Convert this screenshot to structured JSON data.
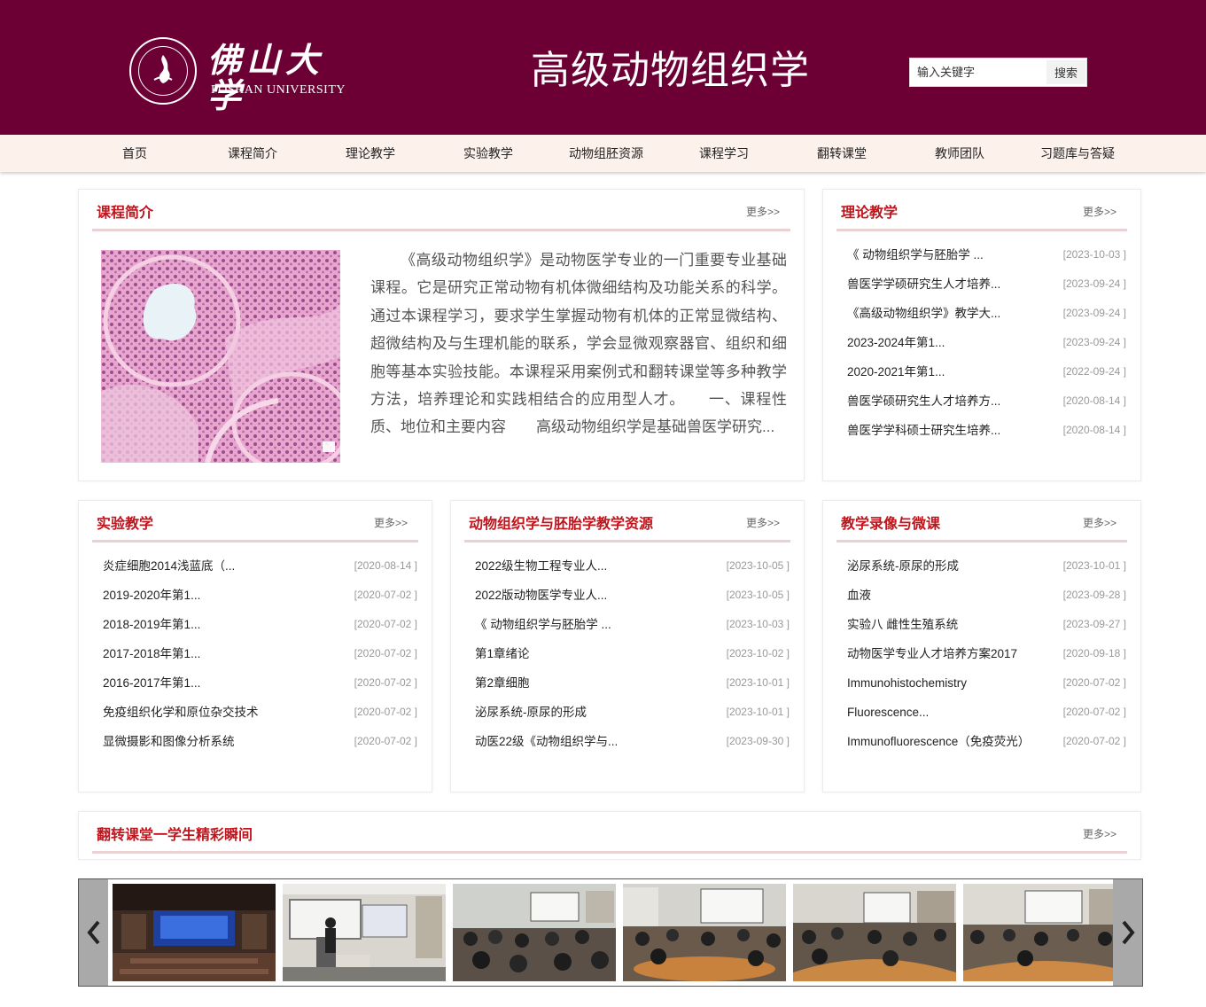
{
  "header": {
    "logo_cn": "佛山大学",
    "logo_en": "FOSHAN UNIVERSITY",
    "title": "高级动物组织学",
    "search_placeholder": "输入关键字",
    "search_button": "搜索"
  },
  "nav": {
    "items": [
      "首页",
      "课程简介",
      "理论教学",
      "实验教学",
      "动物组胚资源",
      "课程学习",
      "翻转课堂",
      "教师团队",
      "习题库与答疑"
    ]
  },
  "more_label": "更多>>",
  "intro": {
    "title": "课程简介",
    "image_icon": "histology-image",
    "text": "《高级动物组织学》是动物医学专业的一门重要专业基础课程。它是研究正常动物有机体微细结构及功能关系的科学。通过本课程学习，要求学生掌握动物有机体的正常显微结构、超微结构及与生理机能的联系，学会显微观察器官、组织和细胞等基本实验技能。本课程采用案例式和翻转课堂等多种教学方法，培养理论和实践相结合的应用型人才。　　一、课程性质、地位和主要内容　　高级动物组织学是基础兽医学研究..."
  },
  "theory": {
    "title": "理论教学",
    "items": [
      {
        "title": "《 动物组织学与胚胎学 ...",
        "date": "[2023-10-03 ]"
      },
      {
        "title": "兽医学学硕研究生人才培养...",
        "date": "[2023-09-24 ]"
      },
      {
        "title": "《高级动物组织学》教学大...",
        "date": "[2023-09-24 ]"
      },
      {
        "title": "2023-2024年第1...",
        "date": "[2023-09-24 ]"
      },
      {
        "title": "2020-2021年第1...",
        "date": "[2022-09-24 ]"
      },
      {
        "title": "兽医学硕研究生人才培养方...",
        "date": "[2020-08-14 ]"
      },
      {
        "title": "兽医学学科硕士研究生培养...",
        "date": "[2020-08-14 ]"
      }
    ]
  },
  "experiment": {
    "title": "实验教学",
    "items": [
      {
        "title": "炎症细胞2014浅蓝底（...",
        "date": "[2020-08-14 ]"
      },
      {
        "title": "2019-2020年第1...",
        "date": "[2020-07-02 ]"
      },
      {
        "title": "2018-2019年第1...",
        "date": "[2020-07-02 ]"
      },
      {
        "title": "2017-2018年第1...",
        "date": "[2020-07-02 ]"
      },
      {
        "title": "2016-2017年第1...",
        "date": "[2020-07-02 ]"
      },
      {
        "title": "免疫组织化学和原位杂交技术",
        "date": "[2020-07-02 ]"
      },
      {
        "title": "显微摄影和图像分析系统",
        "date": "[2020-07-02 ]"
      }
    ]
  },
  "resources": {
    "title": "动物组织学与胚胎学教学资源",
    "items": [
      {
        "title": "2022级生物工程专业人...",
        "date": "[2023-10-05 ]"
      },
      {
        "title": "2022版动物医学专业人...",
        "date": "[2023-10-05 ]"
      },
      {
        "title": "《 动物组织学与胚胎学 ...",
        "date": "[2023-10-03 ]"
      },
      {
        "title": "第1章绪论",
        "date": "[2023-10-02 ]"
      },
      {
        "title": "第2章细胞",
        "date": "[2023-10-01 ]"
      },
      {
        "title": "泌尿系统-原尿的形成",
        "date": "[2023-10-01 ]"
      },
      {
        "title": "动医22级《动物组织学与...",
        "date": "[2023-09-30 ]"
      }
    ]
  },
  "videos": {
    "title": "教学录像与微课",
    "items": [
      {
        "title": "泌尿系统-原尿的形成",
        "date": "[2023-10-01 ]"
      },
      {
        "title": "血液",
        "date": "[2023-09-28 ]"
      },
      {
        "title": "实验八 雌性生殖系统",
        "date": "[2023-09-27 ]"
      },
      {
        "title": "动物医学专业人才培养方案2017",
        "date": "[2020-09-18 ]"
      },
      {
        "title": "Immunohistochemistry",
        "date": "[2020-07-02 ]"
      },
      {
        "title": "Fluorescence...",
        "date": "[2020-07-02 ]"
      },
      {
        "title": "Immunofluorescence（免疫荧光）",
        "date": "[2020-07-02 ]"
      }
    ]
  },
  "flipped": {
    "title": "翻转课堂一学生精彩瞬间"
  },
  "carousel": {
    "left_icon": "chevron-left-icon",
    "right_icon": "chevron-right-icon",
    "photos": [
      "lecture-hall-photo",
      "speaker-podium-photo",
      "classroom-photo",
      "classroom-photo",
      "classroom-photo",
      "classroom-photo"
    ]
  },
  "colors": {
    "header_bg": "#6c0035",
    "nav_bg": "#fdf1ec",
    "title_red": "#c0141c",
    "divider": "#ead1d3"
  }
}
